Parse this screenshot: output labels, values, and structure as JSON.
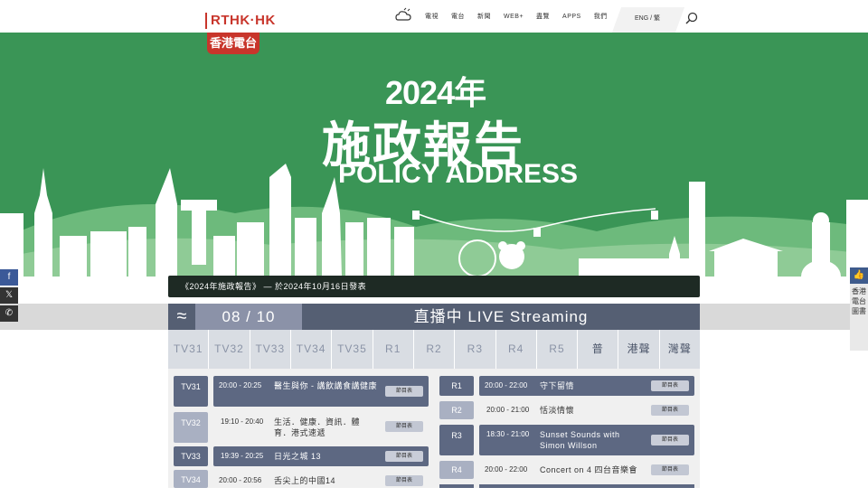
{
  "logo": {
    "top": "RTHK·HK",
    "bottom": "香港電台"
  },
  "nav": {
    "items": [
      "電視",
      "電台",
      "新聞",
      "WEB+",
      "盡覽",
      "APPS",
      "我們"
    ],
    "lang": "ENG / 繁"
  },
  "banner": {
    "year": "2024年",
    "title_zh": "施政報告",
    "title_en": "POLICY ADDRESS",
    "caption": "《2024年施政報告》 — 於2024年10月16日發表"
  },
  "social": {
    "facebook": "f",
    "x": "𝕏",
    "whatsapp": "✆"
  },
  "side_right": {
    "text": "香港電台圖書"
  },
  "live": {
    "date": "08 / 10",
    "title": "直播中 LIVE Streaming"
  },
  "tabs": [
    "TV31",
    "TV32",
    "TV33",
    "TV34",
    "TV35",
    "R1",
    "R2",
    "R3",
    "R4",
    "R5",
    "普",
    "港聲",
    "灣聲"
  ],
  "tv": [
    {
      "chan": "TV31",
      "time": "20:00 - 20:25",
      "title": "醫生與你 - 講飲講食講健康",
      "btn": "節目表",
      "style": "dark"
    },
    {
      "chan": "TV32",
      "time": "19:10 - 20:40",
      "title": "生活．健康．資訊．體育．港式速遞",
      "btn": "節目表",
      "style": "light"
    },
    {
      "chan": "TV33",
      "time": "19:39 - 20:25",
      "title": "日光之城 13",
      "btn": "節目表",
      "style": "dark"
    },
    {
      "chan": "TV34",
      "time": "20:00 - 20:56",
      "title": "舌尖上的中國14",
      "btn": "節目表",
      "style": "light"
    }
  ],
  "radio": [
    {
      "chan": "R1",
      "time": "20:00 - 22:00",
      "title": "守下留情",
      "btn": "節目表",
      "style": "dark"
    },
    {
      "chan": "R2",
      "time": "20:00 - 21:00",
      "title": "恬淡情懷",
      "btn": "節目表",
      "style": "light"
    },
    {
      "chan": "R3",
      "time": "18:30 - 21:00",
      "title": "Sunset Sounds with Simon Willson",
      "btn": "節目表",
      "style": "dark"
    },
    {
      "chan": "R4",
      "time": "20:00 - 22:00",
      "title": "Concert on 4 四台音樂會",
      "btn": "節目表",
      "style": "light"
    }
  ]
}
